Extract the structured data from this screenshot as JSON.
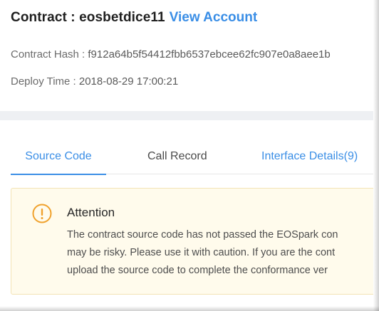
{
  "header": {
    "contract_label": "Contract : eosbetdice11",
    "view_account": "View Account"
  },
  "meta": {
    "hash_label": "Contract Hash : ",
    "hash_value": "f912a64b5f54412fbb6537ebcee62fc907e0a8aee1b",
    "deploy_label": "Deploy Time : ",
    "deploy_value": "2018-08-29 17:00:21"
  },
  "tabs": [
    {
      "label": "Source Code",
      "active": true
    },
    {
      "label": "Call Record",
      "active": false
    },
    {
      "label": "Interface Details(9)",
      "active": false
    }
  ],
  "attention": {
    "title": "Attention",
    "lines": [
      "The contract source code has not passed the EOSpark con",
      "may be risky. Please use it with caution. If you are the cont",
      "upload the source code to complete the conformance ver"
    ],
    "icon": "exclamation-circle-icon"
  },
  "colors": {
    "accent": "#3a8ee6",
    "warning_bg": "#fffbec",
    "warning_border": "#f3e3b5",
    "warning_icon": "#f0a12c"
  }
}
